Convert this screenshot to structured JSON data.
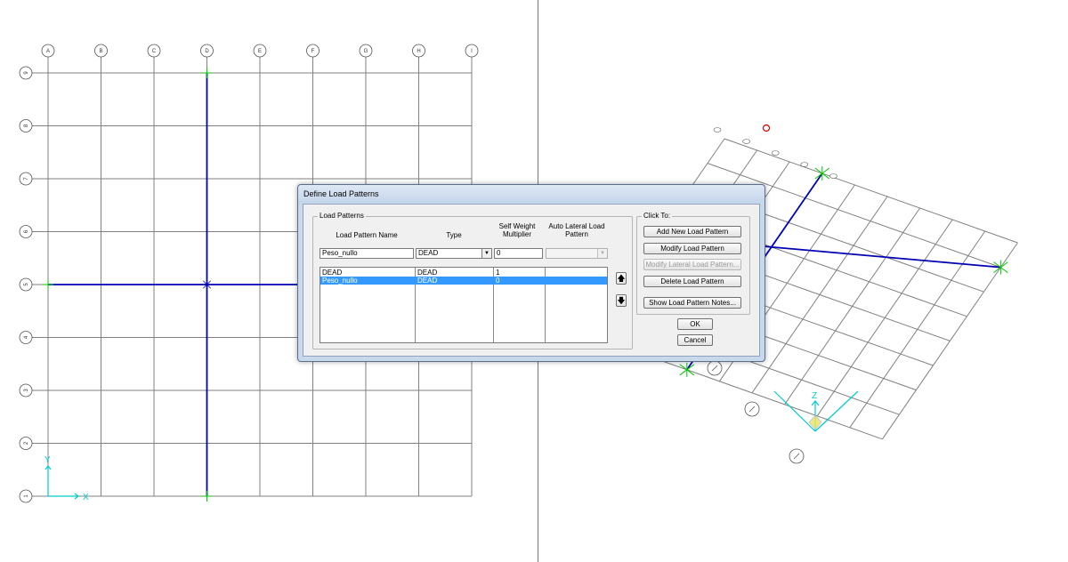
{
  "left_view": {
    "grid_x_labels": [
      "A",
      "B",
      "C",
      "D",
      "E",
      "F",
      "G",
      "H",
      "I"
    ],
    "grid_y_labels": [
      "9",
      "8",
      "7",
      "6",
      "5",
      "4",
      "3",
      "2",
      "1"
    ],
    "axis_x_label": "X",
    "axis_y_label": "Y"
  },
  "right_view": {
    "axis_z_label": "Z"
  },
  "colors": {
    "grid": "#808080",
    "frame": "#0000b4",
    "support": "#00c800",
    "axis": "#00cccc",
    "dialog_selection": "#3399ff"
  },
  "dialog": {
    "title": "Define Load Patterns",
    "patterns_group_label": "Load Patterns",
    "headers": {
      "name": "Load Pattern Name",
      "type": "Type",
      "self_weight": "Self Weight Multiplier",
      "auto_lateral": "Auto Lateral Load Pattern"
    },
    "edit_row": {
      "name": "Peso_nullo",
      "type": "DEAD",
      "multiplier": "0",
      "auto_lateral": ""
    },
    "rows": [
      {
        "name": "DEAD",
        "type": "DEAD",
        "multiplier": "1",
        "auto_lateral": ""
      },
      {
        "name": "Peso_nullo",
        "type": "DEAD",
        "multiplier": "0",
        "auto_lateral": ""
      }
    ],
    "selected_row": 1,
    "move_up_symbol": "🡅",
    "move_down_symbol": "🡇",
    "click_to_group_label": "Click To:",
    "buttons": {
      "add": "Add New Load Pattern",
      "modify": "Modify Load Pattern",
      "modify_lateral": "Modify Lateral Load Pattern...",
      "delete": "Delete Load Pattern",
      "notes": "Show Load Pattern Notes...",
      "ok": "OK",
      "cancel": "Cancel"
    }
  }
}
